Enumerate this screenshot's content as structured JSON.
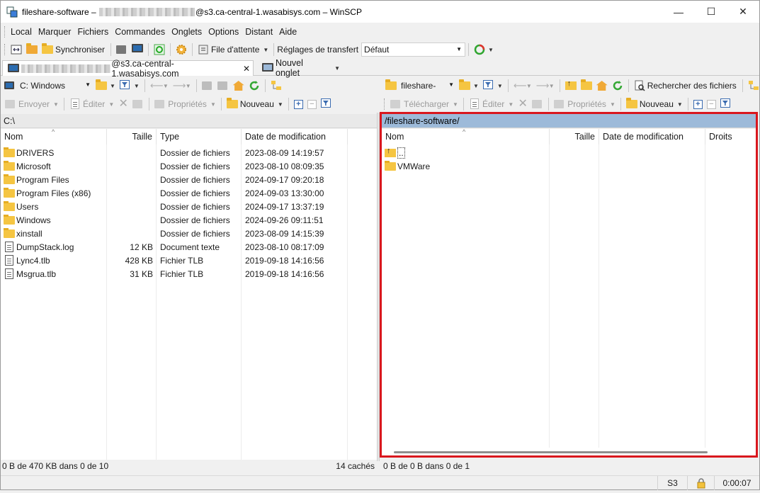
{
  "window": {
    "title_prefix": "fileshare-software – ",
    "title_suffix": "@s3.ca-central-1.wasabisys.com – WinSCP"
  },
  "menu": [
    "Local",
    "Marquer",
    "Fichiers",
    "Commandes",
    "Onglets",
    "Options",
    "Distant",
    "Aide"
  ],
  "toolbar": {
    "synchronize": "Synchroniser",
    "queue": "File d'attente",
    "transfer_settings": "Réglages de transfert",
    "transfer_value": "Défaut"
  },
  "tabs": {
    "session_suffix": "@s3.ca-central-1.wasabisys.com",
    "close": "✕",
    "new_tab": "Nouvel onglet"
  },
  "left": {
    "drive": "C: Windows",
    "actions": {
      "send": "Envoyer",
      "edit": "Éditer",
      "properties": "Propriétés",
      "new": "Nouveau"
    },
    "path": "C:\\",
    "columns": [
      "Nom",
      "Taille",
      "Type",
      "Date de modification"
    ],
    "rows": [
      {
        "name": "DRIVERS",
        "size": "",
        "type": "Dossier de fichiers",
        "date": "2023-08-09 14:19:57",
        "icon": "folder"
      },
      {
        "name": "Microsoft",
        "size": "",
        "type": "Dossier de fichiers",
        "date": "2023-08-10 08:09:35",
        "icon": "folder"
      },
      {
        "name": "Program Files",
        "size": "",
        "type": "Dossier de fichiers",
        "date": "2024-09-17 09:20:18",
        "icon": "folder"
      },
      {
        "name": "Program Files (x86)",
        "size": "",
        "type": "Dossier de fichiers",
        "date": "2024-09-03 13:30:00",
        "icon": "folder"
      },
      {
        "name": "Users",
        "size": "",
        "type": "Dossier de fichiers",
        "date": "2024-09-17 13:37:19",
        "icon": "folder"
      },
      {
        "name": "Windows",
        "size": "",
        "type": "Dossier de fichiers",
        "date": "2024-09-26 09:11:51",
        "icon": "folder"
      },
      {
        "name": "xinstall",
        "size": "",
        "type": "Dossier de fichiers",
        "date": "2023-08-09 14:15:39",
        "icon": "folder"
      },
      {
        "name": "DumpStack.log",
        "size": "12 KB",
        "type": "Document texte",
        "date": "2023-08-10 08:17:09",
        "icon": "file"
      },
      {
        "name": "Lync4.tlb",
        "size": "428 KB",
        "type": "Fichier TLB",
        "date": "2019-09-18 14:16:56",
        "icon": "file"
      },
      {
        "name": "Msgrua.tlb",
        "size": "31 KB",
        "type": "Fichier TLB",
        "date": "2019-09-18 14:16:56",
        "icon": "file"
      }
    ],
    "status": "0 B de 470 KB dans 0 de 10",
    "cached": "14 cachés"
  },
  "right": {
    "drive": "fileshare-",
    "search": "Rechercher des fichiers",
    "actions": {
      "download": "Télécharger",
      "edit": "Éditer",
      "properties": "Propriétés",
      "new": "Nouveau"
    },
    "path": "/fileshare-software/",
    "columns": [
      "Nom",
      "Taille",
      "Date de modification",
      "Droits"
    ],
    "rows": [
      {
        "name": "..",
        "icon": "up"
      },
      {
        "name": "VMWare",
        "icon": "folder"
      }
    ],
    "status": "0 B de 0 B dans 0 de 1"
  },
  "bottom": {
    "protocol": "S3",
    "elapsed": "0:00:07"
  }
}
